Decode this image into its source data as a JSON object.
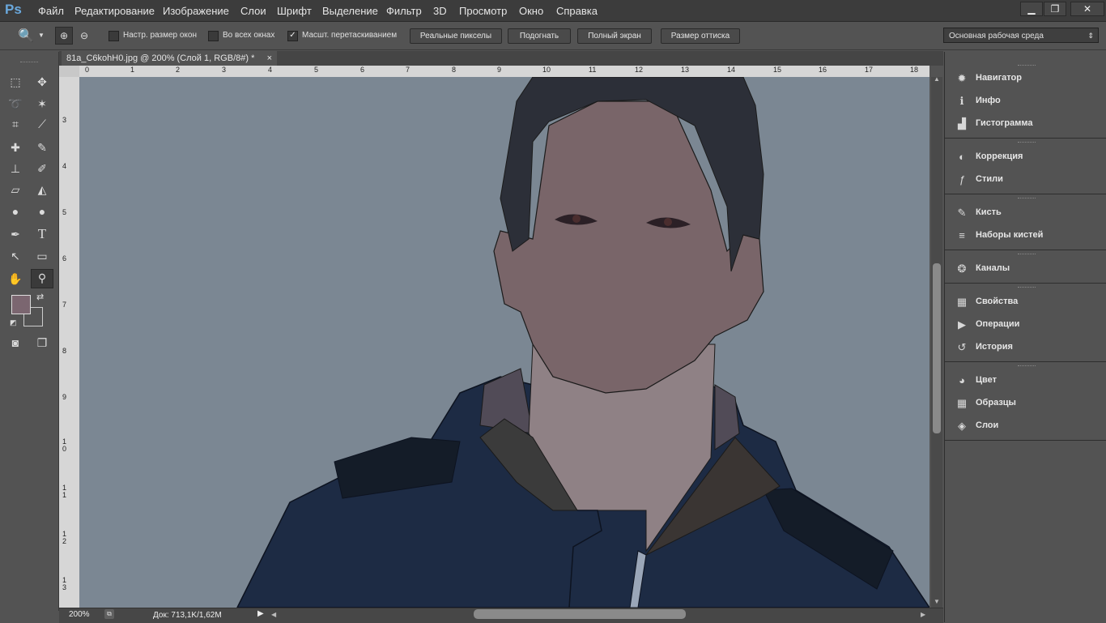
{
  "app": {
    "logo": "Ps"
  },
  "menu": [
    "Файл",
    "Редактирование",
    "Изображение",
    "Слои",
    "Шрифт",
    "Выделение",
    "Фильтр",
    "3D",
    "Просмотр",
    "Окно",
    "Справка"
  ],
  "options": {
    "checkboxes": [
      {
        "label": "Настр. размер окон",
        "checked": false
      },
      {
        "label": "Во всех окнах",
        "checked": false
      },
      {
        "label": "Масшт. перетаскиванием",
        "checked": true
      }
    ],
    "buttons": [
      "Реальные пикселы",
      "Подогнать",
      "Полный экран",
      "Размер оттиска"
    ],
    "workspace": "Основная рабочая среда"
  },
  "document": {
    "tab_title": "81a_C6kohH0.jpg @ 200% (Слой 1, RGB/8#) *",
    "close": "×"
  },
  "rulers": {
    "h": [
      "0",
      "1",
      "2",
      "3",
      "4",
      "5",
      "6",
      "7",
      "8",
      "9",
      "10",
      "11",
      "12",
      "13",
      "14",
      "15",
      "16",
      "17",
      "18"
    ],
    "v": [
      "3",
      "4",
      "5",
      "6",
      "7",
      "8",
      "9",
      "10",
      "11",
      "12",
      "13"
    ]
  },
  "status": {
    "zoom": "200%",
    "doc": "Док: 713,1K/1,62M"
  },
  "colors": {
    "foreground": "#7b6670",
    "background": "#535353",
    "canvas": "#7b8793"
  },
  "panels": [
    [
      {
        "label": "Навигатор",
        "icon": "navigator-icon",
        "glyph": "✹"
      },
      {
        "label": "Инфо",
        "icon": "info-icon",
        "glyph": "ℹ"
      },
      {
        "label": "Гистограмма",
        "icon": "histogram-icon",
        "glyph": "▟"
      }
    ],
    [
      {
        "label": "Коррекция",
        "icon": "adjustments-icon",
        "glyph": "◐"
      },
      {
        "label": "Стили",
        "icon": "styles-icon",
        "glyph": "ƒ"
      }
    ],
    [
      {
        "label": "Кисть",
        "icon": "brush-icon",
        "glyph": "✎"
      },
      {
        "label": "Наборы кистей",
        "icon": "brush-presets-icon",
        "glyph": "≡"
      }
    ],
    [
      {
        "label": "Каналы",
        "icon": "channels-icon",
        "glyph": "❂"
      }
    ],
    [
      {
        "label": "Свойства",
        "icon": "properties-icon",
        "glyph": "▦"
      },
      {
        "label": "Операции",
        "icon": "actions-icon",
        "glyph": "▶"
      },
      {
        "label": "История",
        "icon": "history-icon",
        "glyph": "↺"
      }
    ],
    [
      {
        "label": "Цвет",
        "icon": "color-icon",
        "glyph": "◕"
      },
      {
        "label": "Образцы",
        "icon": "swatches-icon",
        "glyph": "▦"
      },
      {
        "label": "Слои",
        "icon": "layers-icon",
        "glyph": "◈"
      }
    ]
  ],
  "tools": [
    {
      "name": "marquee-tool-icon",
      "glyph": "⬚"
    },
    {
      "name": "move-tool-icon",
      "glyph": "✥"
    },
    {
      "name": "lasso-tool-icon",
      "glyph": "➰"
    },
    {
      "name": "magic-wand-tool-icon",
      "glyph": "✶"
    },
    {
      "name": "crop-tool-icon",
      "glyph": "⌗"
    },
    {
      "name": "eyedropper-tool-icon",
      "glyph": "⟋"
    },
    {
      "name": "healing-tool-icon",
      "glyph": "✚"
    },
    {
      "name": "brush-tool-icon",
      "glyph": "✎"
    },
    {
      "name": "stamp-tool-icon",
      "glyph": "⊥"
    },
    {
      "name": "history-brush-tool-icon",
      "glyph": "✐"
    },
    {
      "name": "eraser-tool-icon",
      "glyph": "▱"
    },
    {
      "name": "bucket-tool-icon",
      "glyph": "◭"
    },
    {
      "name": "blur-tool-icon",
      "glyph": "💧"
    },
    {
      "name": "dodge-tool-icon",
      "glyph": "●"
    },
    {
      "name": "pen-tool-icon",
      "glyph": "✒"
    },
    {
      "name": "type-tool-icon",
      "glyph": "T"
    },
    {
      "name": "path-select-tool-icon",
      "glyph": "↖"
    },
    {
      "name": "rectangle-tool-icon",
      "glyph": "▭"
    },
    {
      "name": "hand-tool-icon",
      "glyph": "✋"
    },
    {
      "name": "zoom-tool-icon",
      "glyph": "🔍"
    }
  ]
}
